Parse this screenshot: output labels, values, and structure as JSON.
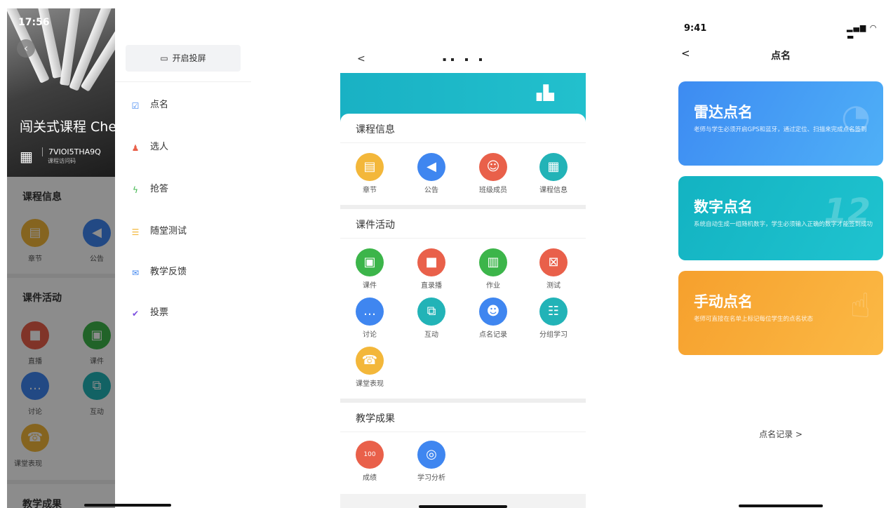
{
  "screen1": {
    "time": "17:56",
    "course_title": "闯关式课程 Che",
    "course_code": "7VIOI5THA9Q",
    "course_code_label": "课程访问码",
    "sections": {
      "info": "课程信息",
      "activity": "课件活动",
      "results": "教学成果"
    },
    "info_items": [
      "章节",
      "公告"
    ],
    "activity_items": [
      "直播",
      "课件",
      "讨论",
      "互动",
      "课堂表现"
    ],
    "drawer": {
      "cast_label": "开启投屏",
      "items": [
        "点名",
        "选人",
        "抢答",
        "随堂测试",
        "教学反馈",
        "投票"
      ]
    }
  },
  "screen2": {
    "back": "<",
    "sections": {
      "info": "课程信息",
      "activity": "课件活动",
      "results": "教学成果"
    },
    "info_items": [
      "章节",
      "公告",
      "班级成员",
      "课程信息"
    ],
    "activity_items": [
      "课件",
      "直录播",
      "作业",
      "测试",
      "讨论",
      "互动",
      "点名记录",
      "分组学习",
      "课堂表现"
    ],
    "results_items": [
      "成绩",
      "学习分析"
    ],
    "results_badge": "100"
  },
  "screen3": {
    "time": "9:41",
    "back": "<",
    "title": "点名",
    "modes": [
      {
        "title": "雷达点名",
        "desc": "老师与学生必须开启GPS和蓝牙，通过定位、扫描来完成点名签到",
        "color": "#4a9af5"
      },
      {
        "title": "数字点名",
        "desc": "系统自动生成一组随机数字，学生必须输入正确的数字才能签到成功",
        "color": "#17b8c6"
      },
      {
        "title": "手动点名",
        "desc": "老师可直接在名单上标记每位学生的点名状态",
        "color": "#f7a433"
      }
    ],
    "record_link": "点名记录 >"
  },
  "colors": {
    "yellow": "#f3b73a",
    "blue": "#3f86f0",
    "red": "#e9604a",
    "green": "#3cb54a",
    "teal": "#22b3b7"
  }
}
